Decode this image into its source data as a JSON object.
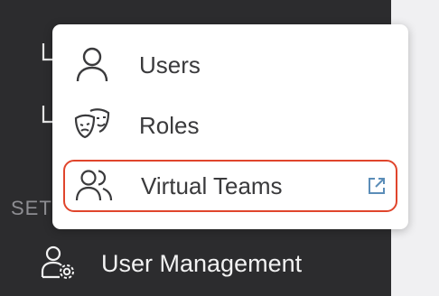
{
  "sidebar": {
    "section_label": "SET",
    "nav_item": {
      "label": "User Management",
      "icon": "user-settings-icon"
    }
  },
  "menu": {
    "items": [
      {
        "label": "Users",
        "icon": "user-icon"
      },
      {
        "label": "Roles",
        "icon": "theater-masks-icon"
      },
      {
        "label": "Virtual Teams",
        "icon": "users-icon",
        "trailing_icon": "external-link-icon",
        "highlighted": true
      }
    ]
  },
  "colors": {
    "sidebar_bg": "#2c2c2e",
    "menu_bg": "#ffffff",
    "highlight_border": "#e0452c",
    "icon_blue": "#5b8db8"
  }
}
